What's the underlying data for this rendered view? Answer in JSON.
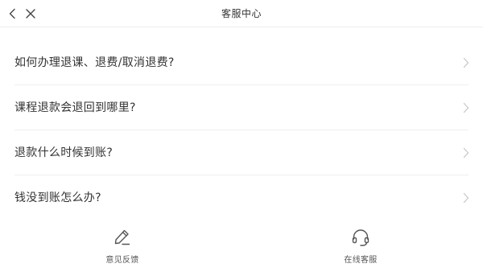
{
  "header": {
    "title": "客服中心",
    "back_icon": "chevron-left-icon",
    "close_icon": "close-icon"
  },
  "faq": {
    "items": [
      {
        "label": "如何办理退课、退费/取消退费?"
      },
      {
        "label": "课程退款会退回到哪里?"
      },
      {
        "label": "退款什么时候到账?"
      },
      {
        "label": "钱没到账怎么办?"
      }
    ],
    "arrow_icon": "chevron-right-icon"
  },
  "bottom_bar": {
    "feedback": {
      "label": "意见反馈",
      "icon": "pencil-icon"
    },
    "service": {
      "label": "在线客服",
      "icon": "headset-icon"
    }
  },
  "colors": {
    "text": "#333333",
    "divider": "#efefef",
    "icon": "#555555",
    "arrow": "#c8c8c8"
  }
}
